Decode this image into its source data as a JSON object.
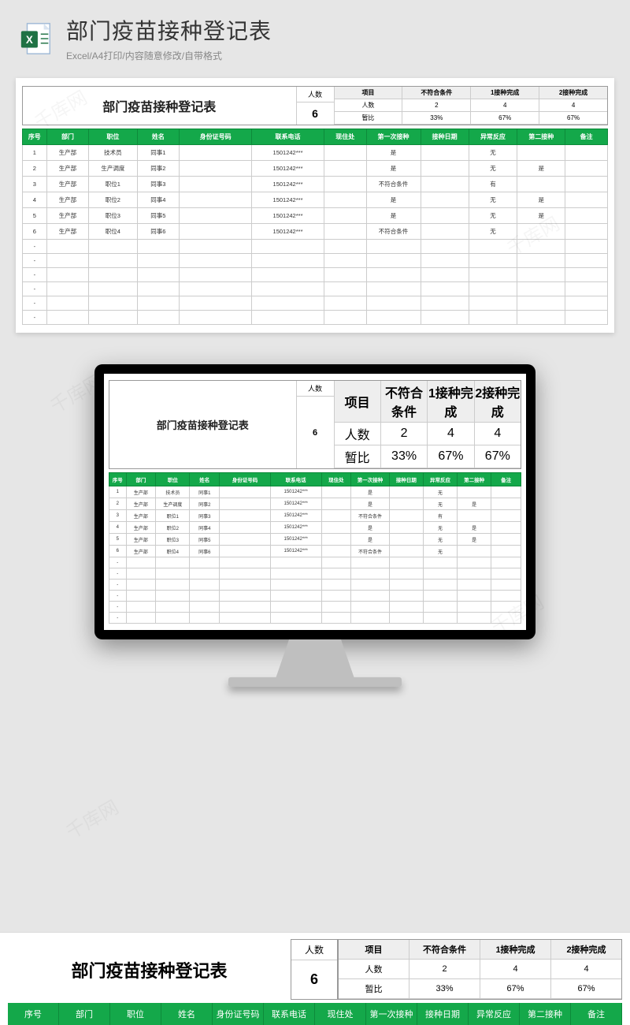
{
  "header": {
    "title": "部门疫苗接种登记表",
    "subtitle": "Excel/A4打印/内容随意修改/自带格式"
  },
  "sheet": {
    "title": "部门疫苗接种登记表",
    "stat_people_label": "人数",
    "stat_people_value": "6",
    "stat_headers": [
      "项目",
      "不符合条件",
      "1接种完成",
      "2接种完成"
    ],
    "stat_row1_label": "人数",
    "stat_row1": [
      "2",
      "4",
      "4"
    ],
    "stat_row2_label": "暂比",
    "stat_row2": [
      "33%",
      "67%",
      "67%"
    ],
    "columns": [
      "序号",
      "部门",
      "职位",
      "姓名",
      "身份证号码",
      "联系电话",
      "现住处",
      "第一次接种",
      "接种日期",
      "异常反应",
      "第二接种",
      "备注"
    ],
    "rows": [
      {
        "seq": "1",
        "dept": "生产部",
        "pos": "技术员",
        "name": "同事1",
        "id": "",
        "phone": "1501242***",
        "addr": "",
        "v1": "是",
        "date": "",
        "react": "无",
        "v2": "",
        "note": ""
      },
      {
        "seq": "2",
        "dept": "生产部",
        "pos": "生产调度",
        "name": "同事2",
        "id": "",
        "phone": "1501242***",
        "addr": "",
        "v1": "是",
        "date": "",
        "react": "无",
        "v2": "是",
        "note": ""
      },
      {
        "seq": "3",
        "dept": "生产部",
        "pos": "职位1",
        "name": "同事3",
        "id": "",
        "phone": "1501242***",
        "addr": "",
        "v1": "不符合条件",
        "date": "",
        "react": "有",
        "v2": "",
        "note": ""
      },
      {
        "seq": "4",
        "dept": "生产部",
        "pos": "职位2",
        "name": "同事4",
        "id": "",
        "phone": "1501242***",
        "addr": "",
        "v1": "是",
        "date": "",
        "react": "无",
        "v2": "是",
        "note": ""
      },
      {
        "seq": "5",
        "dept": "生产部",
        "pos": "职位3",
        "name": "同事5",
        "id": "",
        "phone": "1501242***",
        "addr": "",
        "v1": "是",
        "date": "",
        "react": "无",
        "v2": "是",
        "note": ""
      },
      {
        "seq": "6",
        "dept": "生产部",
        "pos": "职位4",
        "name": "同事6",
        "id": "",
        "phone": "1501242***",
        "addr": "",
        "v1": "不符合条件",
        "date": "",
        "react": "无",
        "v2": "",
        "note": ""
      }
    ],
    "empty_rows": 6
  },
  "watermark": "千库网"
}
